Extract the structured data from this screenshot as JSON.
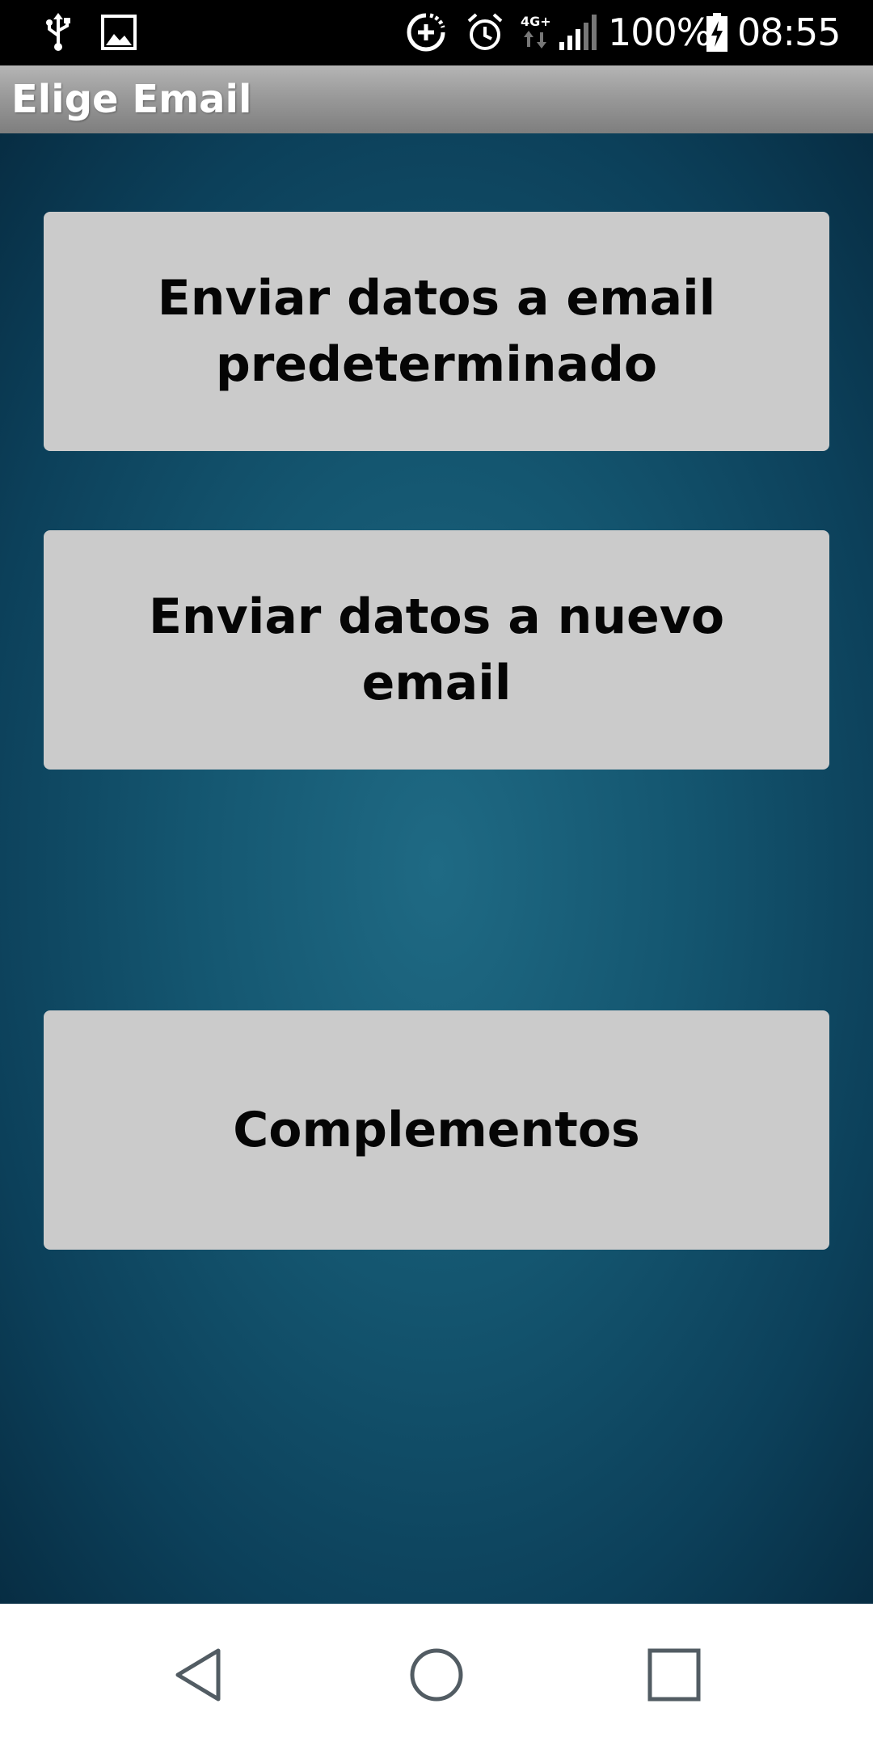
{
  "status_bar": {
    "icons_left": [
      "usb-icon",
      "image-icon"
    ],
    "icons_right": [
      "data-saver-icon",
      "alarm-icon",
      "network-4g-plus-icon",
      "signal-icon",
      "battery-charging-icon"
    ],
    "network_type": "4G+",
    "battery_percent": "100%",
    "time": "08:55"
  },
  "title_bar": {
    "title": "Elige Email"
  },
  "main": {
    "buttons": [
      {
        "label": "Enviar datos a email predeterminado"
      },
      {
        "label": "Enviar datos a nuevo email"
      },
      {
        "label": "Complementos"
      }
    ]
  },
  "nav_bar": {
    "icons": [
      "back-icon",
      "home-icon",
      "recents-icon"
    ]
  },
  "colors": {
    "background_center": "#1f6a84",
    "background_edge": "#072d43",
    "button_bg": "#cbcbcb",
    "button_text": "#050505",
    "title_text": "#ffffff"
  }
}
